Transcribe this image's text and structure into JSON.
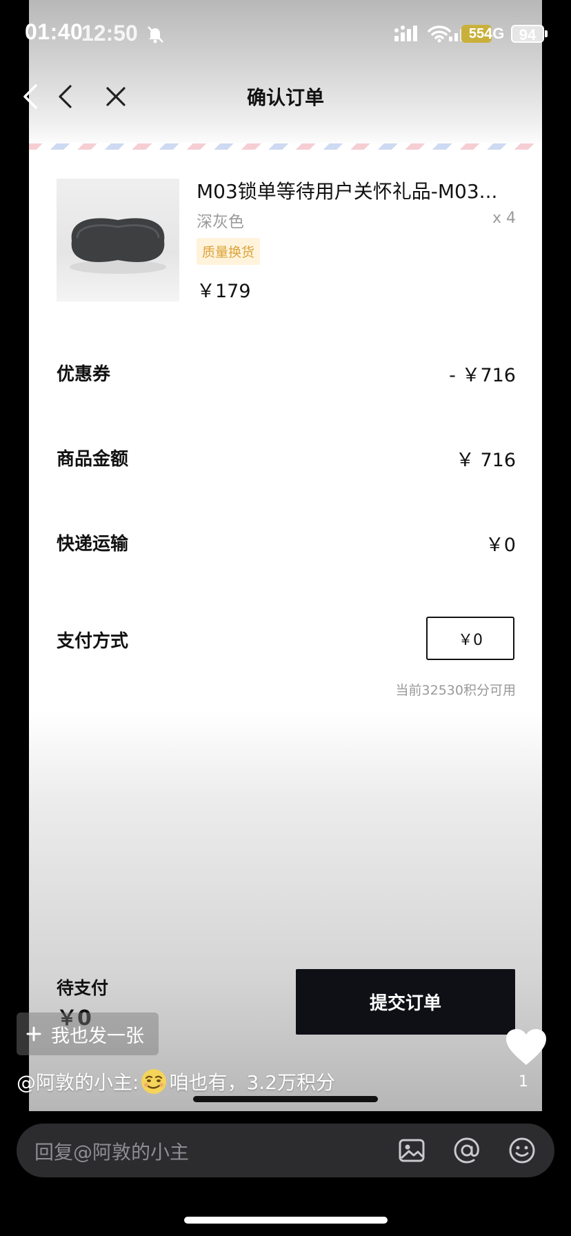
{
  "status_bar": {
    "time_back": "01:40",
    "time_front": "12:50",
    "battery_a": "55",
    "network": "4G",
    "battery_b": "94"
  },
  "header": {
    "title": "确认订单"
  },
  "product": {
    "title": "M03锁单等待用户关怀礼品-M03...",
    "variant": "深灰色",
    "quantity": "x 4",
    "tag": "质量换货",
    "price": "￥179"
  },
  "summary": {
    "coupon_label": "优惠券",
    "coupon_value": "- ￥716",
    "goods_label": "商品金额",
    "goods_value": "￥ 716",
    "shipping_label": "快递运输",
    "shipping_value": "￥0",
    "payment_label": "支付方式",
    "payment_value": "￥0",
    "points_note": "当前32530积分可用"
  },
  "footer": {
    "due_label": "待支付",
    "due_amount": "￥0",
    "submit_label": "提交订单"
  },
  "overlay": {
    "post_button_label": "我也发一张",
    "like_count": "1",
    "comment_author": "@阿敦的小主:",
    "comment_text": "咱也有，3.2万积分",
    "reply_placeholder": "回复@阿敦的小主"
  },
  "icons": {
    "back": "chevron-left-icon",
    "close": "close-icon",
    "image": "image-icon",
    "mention": "at-icon",
    "emoji": "emoji-icon",
    "heart": "heart-icon",
    "plus": "plus-icon"
  }
}
